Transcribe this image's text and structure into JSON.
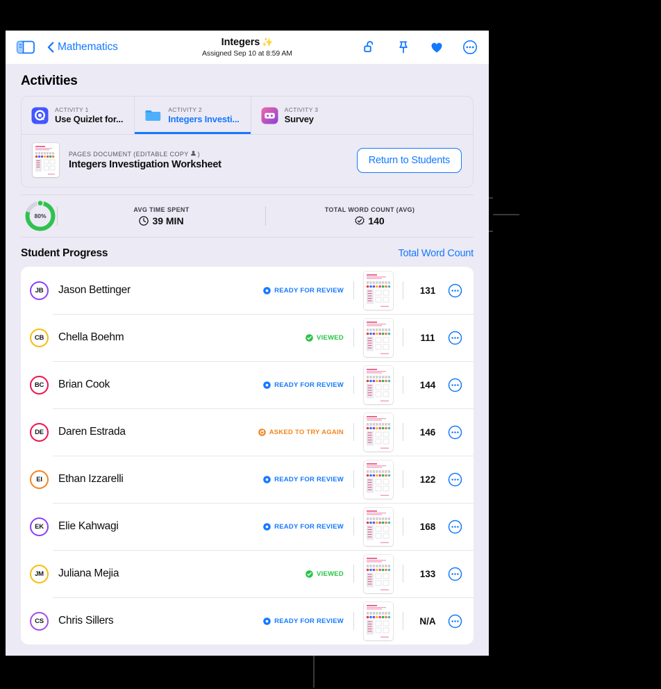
{
  "navbar": {
    "sidebar_toggle": "sidebar-toggle-icon",
    "back_label": "Mathematics",
    "title": "Integers",
    "title_emoji": "✨",
    "subtitle": "Assigned Sep 10 at 8:59 AM",
    "actions": [
      {
        "name": "unlock-icon",
        "label": "Unlock"
      },
      {
        "name": "pin-icon",
        "label": "Pin"
      },
      {
        "name": "heart-icon",
        "label": "Favorite"
      },
      {
        "name": "more-circle-icon",
        "label": "More"
      }
    ],
    "accent_color": "#1479ff"
  },
  "page": {
    "activities_heading": "Activities"
  },
  "tabs": [
    {
      "kicker": "ACTIVITY 1",
      "label": "Use Quizlet for...",
      "icon": "quizlet-icon",
      "active": false
    },
    {
      "kicker": "ACTIVITY 2",
      "label": "Integers Investi...",
      "icon": "folder-icon",
      "active": true
    },
    {
      "kicker": "ACTIVITY 3",
      "label": "Survey",
      "icon": "survey-icon",
      "active": false
    }
  ],
  "document": {
    "kicker": "PAGES DOCUMENT (EDITABLE COPY",
    "kicker_end": ")",
    "title": "Integers Investigation Worksheet",
    "return_button": "Return to Students"
  },
  "stats": {
    "completion_percent": "80%",
    "completion_value": 80,
    "ring_color": "#30c24e",
    "ring_track_color": "#d6d3e0",
    "items": [
      {
        "kicker": "AVG TIME SPENT",
        "value": "39 MIN",
        "icon": "clock-icon"
      },
      {
        "kicker": "TOTAL WORD COUNT (AVG)",
        "value": "140",
        "icon": "checkmark-seal-icon"
      }
    ]
  },
  "student_progress": {
    "title": "Student Progress",
    "sort_label": "Total Word Count",
    "status_colors": {
      "ready": "#1479ff",
      "viewed": "#28c446",
      "retry": "#f38520"
    },
    "students": [
      {
        "initials": "JB",
        "name": "Jason Bettinger",
        "status": "READY FOR REVIEW",
        "status_type": "ready",
        "count": "131",
        "avatar_color": "#8a3ffc"
      },
      {
        "initials": "CB",
        "name": "Chella Boehm",
        "status": "VIEWED",
        "status_type": "viewed",
        "count": "111",
        "avatar_color": "#f5bd0a"
      },
      {
        "initials": "BC",
        "name": "Brian Cook",
        "status": "READY FOR REVIEW",
        "status_type": "ready",
        "count": "144",
        "avatar_color": "#f0104a"
      },
      {
        "initials": "DE",
        "name": "Daren Estrada",
        "status": "ASKED TO TRY AGAIN",
        "status_type": "retry",
        "count": "146",
        "avatar_color": "#f0104a"
      },
      {
        "initials": "EI",
        "name": "Ethan Izzarelli",
        "status": "READY FOR REVIEW",
        "status_type": "ready",
        "count": "122",
        "avatar_color": "#f58220"
      },
      {
        "initials": "EK",
        "name": "Elie Kahwagi",
        "status": "READY FOR REVIEW",
        "status_type": "ready",
        "count": "168",
        "avatar_color": "#8a3ffc"
      },
      {
        "initials": "JM",
        "name": "Juliana Mejia",
        "status": "VIEWED",
        "status_type": "viewed",
        "count": "133",
        "avatar_color": "#f5bd0a"
      },
      {
        "initials": "CS",
        "name": "Chris Sillers",
        "status": "READY FOR REVIEW",
        "status_type": "ready",
        "count": "N/A",
        "avatar_color": "#a04ae8"
      }
    ]
  }
}
